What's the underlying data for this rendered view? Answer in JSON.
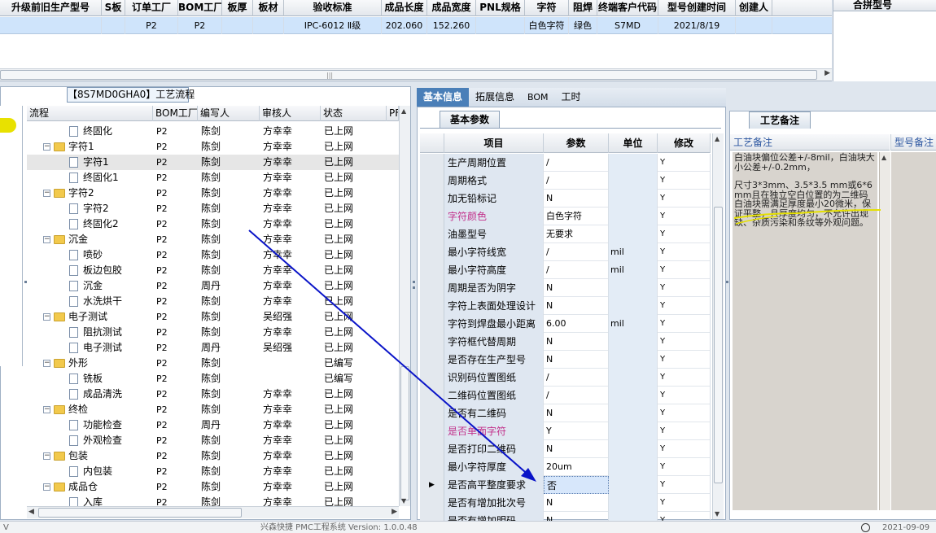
{
  "top_grid": {
    "headers": [
      "升级前旧生产型号",
      "S板",
      "订单工厂",
      "BOM工厂",
      "板厚",
      "板材",
      "验收标准",
      "成品长度",
      "成品宽度",
      "PNL规格",
      "字符",
      "阻焊",
      "终端客户代码",
      "型号创建时间",
      "创建人"
    ],
    "row": [
      "",
      "",
      "P2",
      "P2",
      "",
      "",
      "IPC-6012 Ⅱ级",
      "202.060",
      "152.260",
      "",
      "白色字符",
      "绿色",
      "S7MD",
      "2021/8/19",
      ""
    ],
    "right_header": "合拼型号"
  },
  "left_panel": {
    "caption": "【8S7MD0GHA0】工艺流程",
    "columns": [
      "流程",
      "BOM工厂",
      "编写人",
      "审核人",
      "状态",
      "PF"
    ],
    "rows": [
      {
        "kind": "file",
        "depth": 2,
        "name": "终固化",
        "bom": "P2",
        "writer": "陈剑",
        "reviewer": "方幸幸",
        "status": "已上网"
      },
      {
        "kind": "folder",
        "depth": 1,
        "name": "字符1",
        "bom": "P2",
        "writer": "陈剑",
        "reviewer": "方幸幸",
        "status": "已上网"
      },
      {
        "kind": "file",
        "depth": 2,
        "name": "字符1",
        "bom": "P2",
        "writer": "陈剑",
        "reviewer": "方幸幸",
        "status": "已上网",
        "selected": true
      },
      {
        "kind": "file",
        "depth": 2,
        "name": "终固化1",
        "bom": "P2",
        "writer": "陈剑",
        "reviewer": "方幸幸",
        "status": "已上网"
      },
      {
        "kind": "folder",
        "depth": 1,
        "name": "字符2",
        "bom": "P2",
        "writer": "陈剑",
        "reviewer": "方幸幸",
        "status": "已上网"
      },
      {
        "kind": "file",
        "depth": 2,
        "name": "字符2",
        "bom": "P2",
        "writer": "陈剑",
        "reviewer": "方幸幸",
        "status": "已上网"
      },
      {
        "kind": "file",
        "depth": 2,
        "name": "终固化2",
        "bom": "P2",
        "writer": "陈剑",
        "reviewer": "方幸幸",
        "status": "已上网"
      },
      {
        "kind": "folder",
        "depth": 1,
        "name": "沉金",
        "bom": "P2",
        "writer": "陈剑",
        "reviewer": "方幸幸",
        "status": "已上网"
      },
      {
        "kind": "file",
        "depth": 2,
        "name": "喷砂",
        "bom": "P2",
        "writer": "陈剑",
        "reviewer": "方幸幸",
        "status": "已上网"
      },
      {
        "kind": "file",
        "depth": 2,
        "name": "板边包胶",
        "bom": "P2",
        "writer": "陈剑",
        "reviewer": "方幸幸",
        "status": "已上网"
      },
      {
        "kind": "file",
        "depth": 2,
        "name": "沉金",
        "bom": "P2",
        "writer": "周丹",
        "reviewer": "方幸幸",
        "status": "已上网"
      },
      {
        "kind": "file",
        "depth": 2,
        "name": "水洗烘干",
        "bom": "P2",
        "writer": "陈剑",
        "reviewer": "方幸幸",
        "status": "已上网"
      },
      {
        "kind": "folder",
        "depth": 1,
        "name": "电子测试",
        "bom": "P2",
        "writer": "陈剑",
        "reviewer": "吴绍强",
        "status": "已上网"
      },
      {
        "kind": "file",
        "depth": 2,
        "name": "阻抗测试",
        "bom": "P2",
        "writer": "陈剑",
        "reviewer": "方幸幸",
        "status": "已上网"
      },
      {
        "kind": "file",
        "depth": 2,
        "name": "电子测试",
        "bom": "P2",
        "writer": "周丹",
        "reviewer": "吴绍强",
        "status": "已上网"
      },
      {
        "kind": "folder",
        "depth": 1,
        "name": "外形",
        "bom": "P2",
        "writer": "陈剑",
        "reviewer": "",
        "status": "已编写"
      },
      {
        "kind": "file",
        "depth": 2,
        "name": "铣板",
        "bom": "P2",
        "writer": "陈剑",
        "reviewer": "",
        "status": "已编写"
      },
      {
        "kind": "file",
        "depth": 2,
        "name": "成品清洗",
        "bom": "P2",
        "writer": "陈剑",
        "reviewer": "方幸幸",
        "status": "已上网"
      },
      {
        "kind": "folder",
        "depth": 1,
        "name": "终检",
        "bom": "P2",
        "writer": "陈剑",
        "reviewer": "方幸幸",
        "status": "已上网"
      },
      {
        "kind": "file",
        "depth": 2,
        "name": "功能检查",
        "bom": "P2",
        "writer": "周丹",
        "reviewer": "方幸幸",
        "status": "已上网"
      },
      {
        "kind": "file",
        "depth": 2,
        "name": "外观检查",
        "bom": "P2",
        "writer": "陈剑",
        "reviewer": "方幸幸",
        "status": "已上网"
      },
      {
        "kind": "folder",
        "depth": 1,
        "name": "包装",
        "bom": "P2",
        "writer": "陈剑",
        "reviewer": "方幸幸",
        "status": "已上网"
      },
      {
        "kind": "file",
        "depth": 2,
        "name": "内包装",
        "bom": "P2",
        "writer": "陈剑",
        "reviewer": "方幸幸",
        "status": "已上网"
      },
      {
        "kind": "folder",
        "depth": 1,
        "name": "成品仓",
        "bom": "P2",
        "writer": "陈剑",
        "reviewer": "方幸幸",
        "status": "已上网"
      },
      {
        "kind": "file",
        "depth": 2,
        "name": "入库",
        "bom": "P2",
        "writer": "陈剑",
        "reviewer": "方幸幸",
        "status": "已上网"
      }
    ]
  },
  "mid_panel": {
    "tabs": [
      "基本信息",
      "拓展信息",
      "BOM",
      "工时"
    ],
    "subtab": "基本参数",
    "columns": [
      "项目",
      "参数",
      "单位",
      "修改"
    ],
    "rows": [
      {
        "item": "生产周期位置",
        "param": "/",
        "unit": "",
        "mod": "Y"
      },
      {
        "item": "周期格式",
        "param": "/",
        "unit": "",
        "mod": "Y"
      },
      {
        "item": "加无铅标记",
        "param": "N",
        "unit": "",
        "mod": "Y"
      },
      {
        "item": "字符颜色",
        "param": "白色字符",
        "unit": "",
        "mod": "Y",
        "pink": true
      },
      {
        "item": "油墨型号",
        "param": "无要求",
        "unit": "",
        "mod": "Y"
      },
      {
        "item": "最小字符线宽",
        "param": "/",
        "unit": "mil",
        "mod": "Y"
      },
      {
        "item": "最小字符高度",
        "param": "/",
        "unit": "mil",
        "mod": "Y"
      },
      {
        "item": "周期是否为阴字",
        "param": "N",
        "unit": "",
        "mod": "Y"
      },
      {
        "item": "字符上表面处理设计",
        "param": "N",
        "unit": "",
        "mod": "Y"
      },
      {
        "item": "字符到焊盘最小距离",
        "param": "6.00",
        "unit": "mil",
        "mod": "Y"
      },
      {
        "item": "字符框代替周期",
        "param": "N",
        "unit": "",
        "mod": "Y"
      },
      {
        "item": "是否存在生产型号",
        "param": "N",
        "unit": "",
        "mod": "Y"
      },
      {
        "item": "识别码位置图纸",
        "param": "/",
        "unit": "",
        "mod": "Y"
      },
      {
        "item": "二维码位置图纸",
        "param": "/",
        "unit": "",
        "mod": "Y"
      },
      {
        "item": "是否有二维码",
        "param": "N",
        "unit": "",
        "mod": "Y"
      },
      {
        "item": "是否单面字符",
        "param": "Y",
        "unit": "",
        "mod": "Y",
        "pink": true
      },
      {
        "item": "是否打印二维码",
        "param": "N",
        "unit": "",
        "mod": "Y"
      },
      {
        "item": "最小字符厚度",
        "param": "20um",
        "unit": "",
        "mod": "Y"
      },
      {
        "item": "是否高平整度要求",
        "param": "否",
        "unit": "",
        "mod": "Y",
        "current": true
      },
      {
        "item": "是否有增加批次号",
        "param": "N",
        "unit": "",
        "mod": "Y"
      },
      {
        "item": "是否有增加明码",
        "param": "N",
        "unit": "",
        "mod": "Y"
      }
    ]
  },
  "right_panel": {
    "tab": "工艺备注",
    "col1": "工艺备注",
    "col2": "型号备注",
    "memo_p1": "白油块偏位公差+/-8mil，白油块大小公差+/-0.2mm，",
    "memo_p2": "尺寸3*3mm、3.5*3.5 mm或6*6 mm且在独立空白位置的为二维码白油块需满足厚度最小20微米，保证平整，且厚度均匀，不允许出现缺、杂质污染和条纹等外观问题。"
  },
  "status_bar": {
    "left": "V",
    "center": "兴森快捷 PMC工程系统  Version: 1.0.0.48",
    "right": "2021-09-09"
  },
  "colors": {
    "selection_row": "#cfe4fb",
    "active_tab": "#4a7fb8",
    "pink_label": "#c2318b",
    "annotation_arrow": "#0a14c8",
    "annotation_highlight": "#e5e000"
  }
}
